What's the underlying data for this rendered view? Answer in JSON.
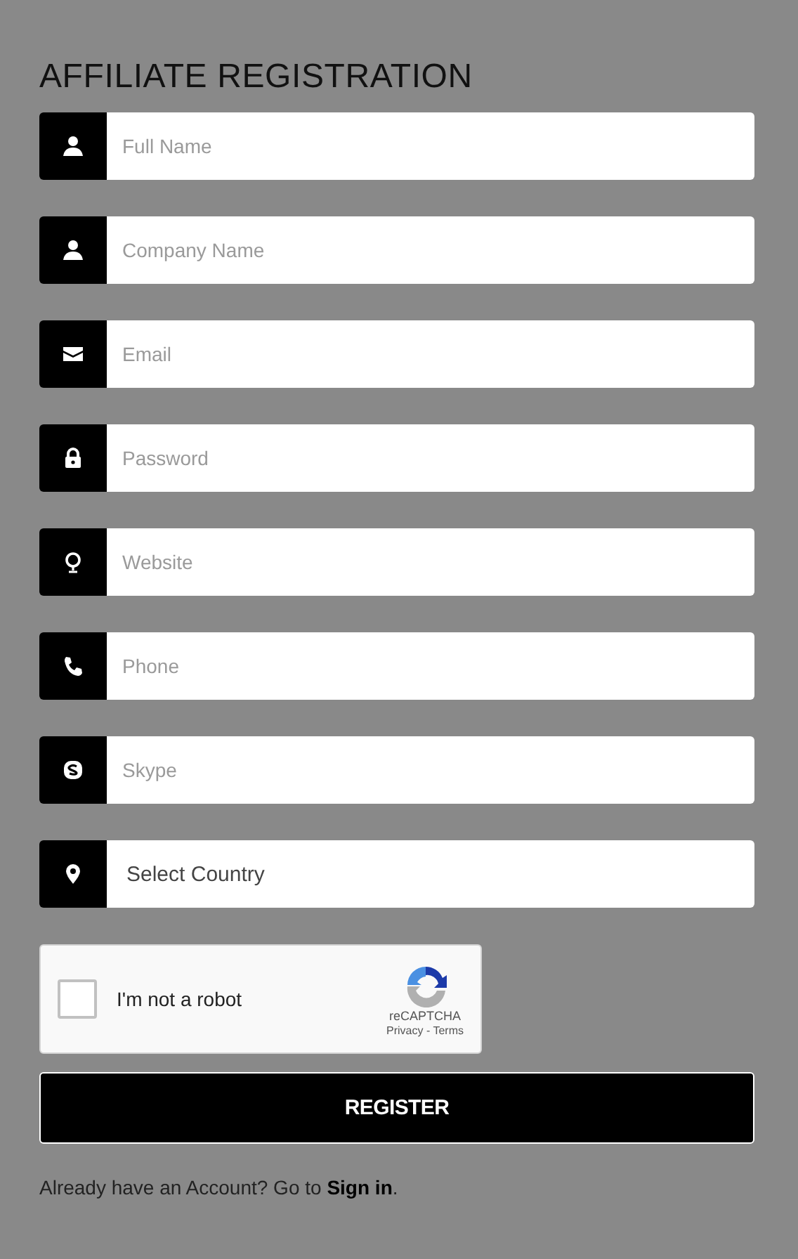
{
  "title": "AFFILIATE REGISTRATION",
  "fields": [
    {
      "kind": "text",
      "placeholder": "Full Name"
    },
    {
      "kind": "text",
      "placeholder": "Company Name"
    },
    {
      "kind": "text",
      "placeholder": "Email"
    },
    {
      "kind": "password",
      "placeholder": "Password"
    },
    {
      "kind": "text",
      "placeholder": "Website"
    },
    {
      "kind": "text",
      "placeholder": "Phone"
    },
    {
      "kind": "text",
      "placeholder": "Skype"
    },
    {
      "kind": "select",
      "value": "Select Country"
    }
  ],
  "captcha": {
    "checked": false,
    "label": "I'm not a robot",
    "brand": "reCAPTCHA",
    "legal": "Privacy - Terms"
  },
  "submit": "REGISTER",
  "footer": {
    "text": "Already have an Account? Go to",
    "link": "Sign in",
    "end": "."
  }
}
